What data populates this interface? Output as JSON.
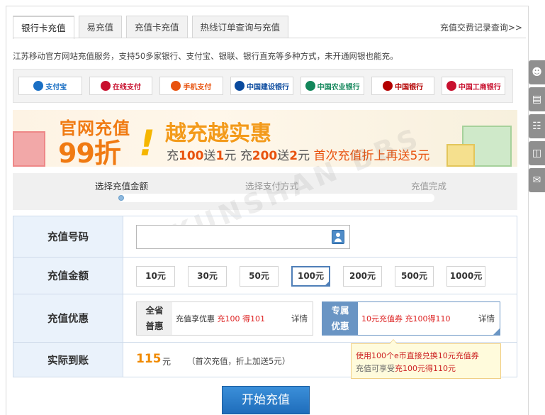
{
  "tabs": [
    {
      "label": "银行卡充值",
      "active": true
    },
    {
      "label": "易充值",
      "active": false
    },
    {
      "label": "充值卡充值",
      "active": false
    },
    {
      "label": "热线订单查询与充值",
      "active": false
    }
  ],
  "records_link": "充值交费记录查询>>",
  "intro": "江苏移动官方网站充值服务，支持50多家银行、支付宝、银联、银行直充等多种方式，未开通网银也能充。",
  "banks": [
    {
      "name": "支付宝",
      "icon": "alipay-icon",
      "color": "#1a6fc4"
    },
    {
      "name": "在线支付",
      "icon": "unionpay-icon",
      "color": "#c8102e"
    },
    {
      "name": "手机支付",
      "icon": "mobile-pay-icon",
      "color": "#e8520e"
    },
    {
      "name": "中国建设银行",
      "icon": "ccb-icon",
      "color": "#0a4a9e"
    },
    {
      "name": "中国农业银行",
      "icon": "abc-icon",
      "color": "#12865a"
    },
    {
      "name": "中国银行",
      "icon": "boc-icon",
      "color": "#b30000"
    },
    {
      "name": "中国工商银行",
      "icon": "icbc-icon",
      "color": "#c8102e"
    }
  ],
  "banner": {
    "title_line1": "官网充值",
    "title_line2": "99折",
    "exclaim": "!",
    "headline": "越充越实惠",
    "sub_parts": [
      "充",
      "100",
      "送",
      "1",
      "元  充",
      "200",
      "送",
      "2",
      "元  ",
      "首次充值折上再送5元"
    ]
  },
  "steps": [
    {
      "label": "选择充值金额",
      "done": true
    },
    {
      "label": "选择支付方式",
      "done": false
    },
    {
      "label": "充值完成",
      "done": false
    }
  ],
  "form": {
    "phone_label": "充值号码",
    "phone_value": "",
    "amount_label": "充值金额",
    "amounts": [
      "10元",
      "30元",
      "50元",
      "100元",
      "200元",
      "500元",
      "1000元"
    ],
    "selected_amount": "100元",
    "offer_label": "充值优惠",
    "offers": [
      {
        "tag": "全省\n普惠",
        "desc_prefix": "充值享优惠 ",
        "desc_red": "充100 得101",
        "detail": "详情",
        "selected": false
      },
      {
        "tag": "专属\n优惠",
        "desc_prefix": "",
        "desc_red": "10元充值券 充100得110",
        "detail": "详情",
        "selected": true
      }
    ],
    "total_label": "实际到账",
    "total_value": "115",
    "total_unit": "元",
    "total_note": "（首次充值，折上加送5元）"
  },
  "tooltip": {
    "line1": "使用100个e币直接兑换10元充值券",
    "line2_prefix": "充值可享受",
    "line2_em": "充100元得110元"
  },
  "submit_label": "开始充值",
  "side_icons": [
    "user-icon",
    "notebook-icon",
    "network-icon",
    "gift-icon",
    "chat-icon"
  ],
  "watermark": "KUNSHAN BBS"
}
